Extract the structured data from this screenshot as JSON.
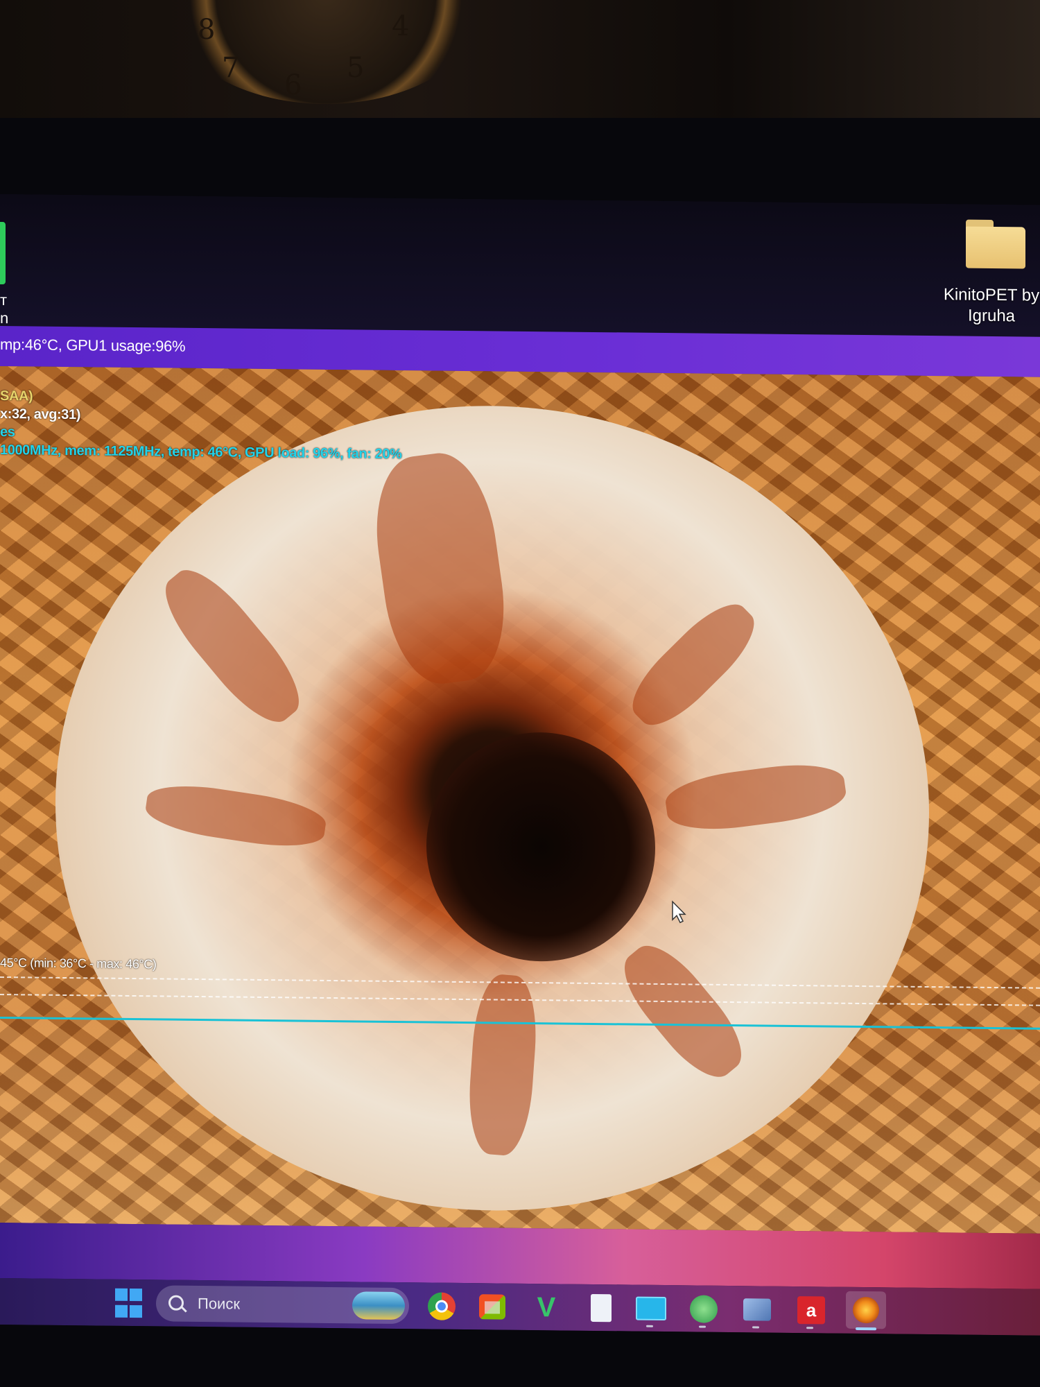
{
  "desktop": {
    "left_icon_label_lines": [
      "т",
      "n"
    ],
    "folder_label": "KinitoPET by Igruha"
  },
  "overlay": {
    "title_bar_text": "mp:46°C, GPU1 usage:96%",
    "line_msaa": "SAA)",
    "line_fps": "x:32, avg:31)",
    "line_es": "es",
    "line_gpu": "1000MHz, mem: 1125MHz, temp: 46°C, GPU load: 96%, fan: 20%",
    "temp_graph_label": "45°C (min: 36°C - max: 46°C)"
  },
  "taskbar": {
    "search_placeholder": "Поиск",
    "amd_glyph": "a",
    "vim_glyph": "V"
  },
  "colors": {
    "title_bar": "#6b2fd6",
    "osd_yellow": "#e8d46a",
    "osd_cyan": "#22d3ea",
    "graph_line": "#19c2d6"
  },
  "icons": [
    "windows-start-icon",
    "search-icon",
    "chrome-icon",
    "ms-store-icon",
    "vim-icon",
    "file-icon",
    "monitor-icon",
    "globe-icon",
    "network-icon",
    "amd-icon",
    "furmark-icon",
    "folder-icon",
    "mouse-cursor-icon"
  ]
}
